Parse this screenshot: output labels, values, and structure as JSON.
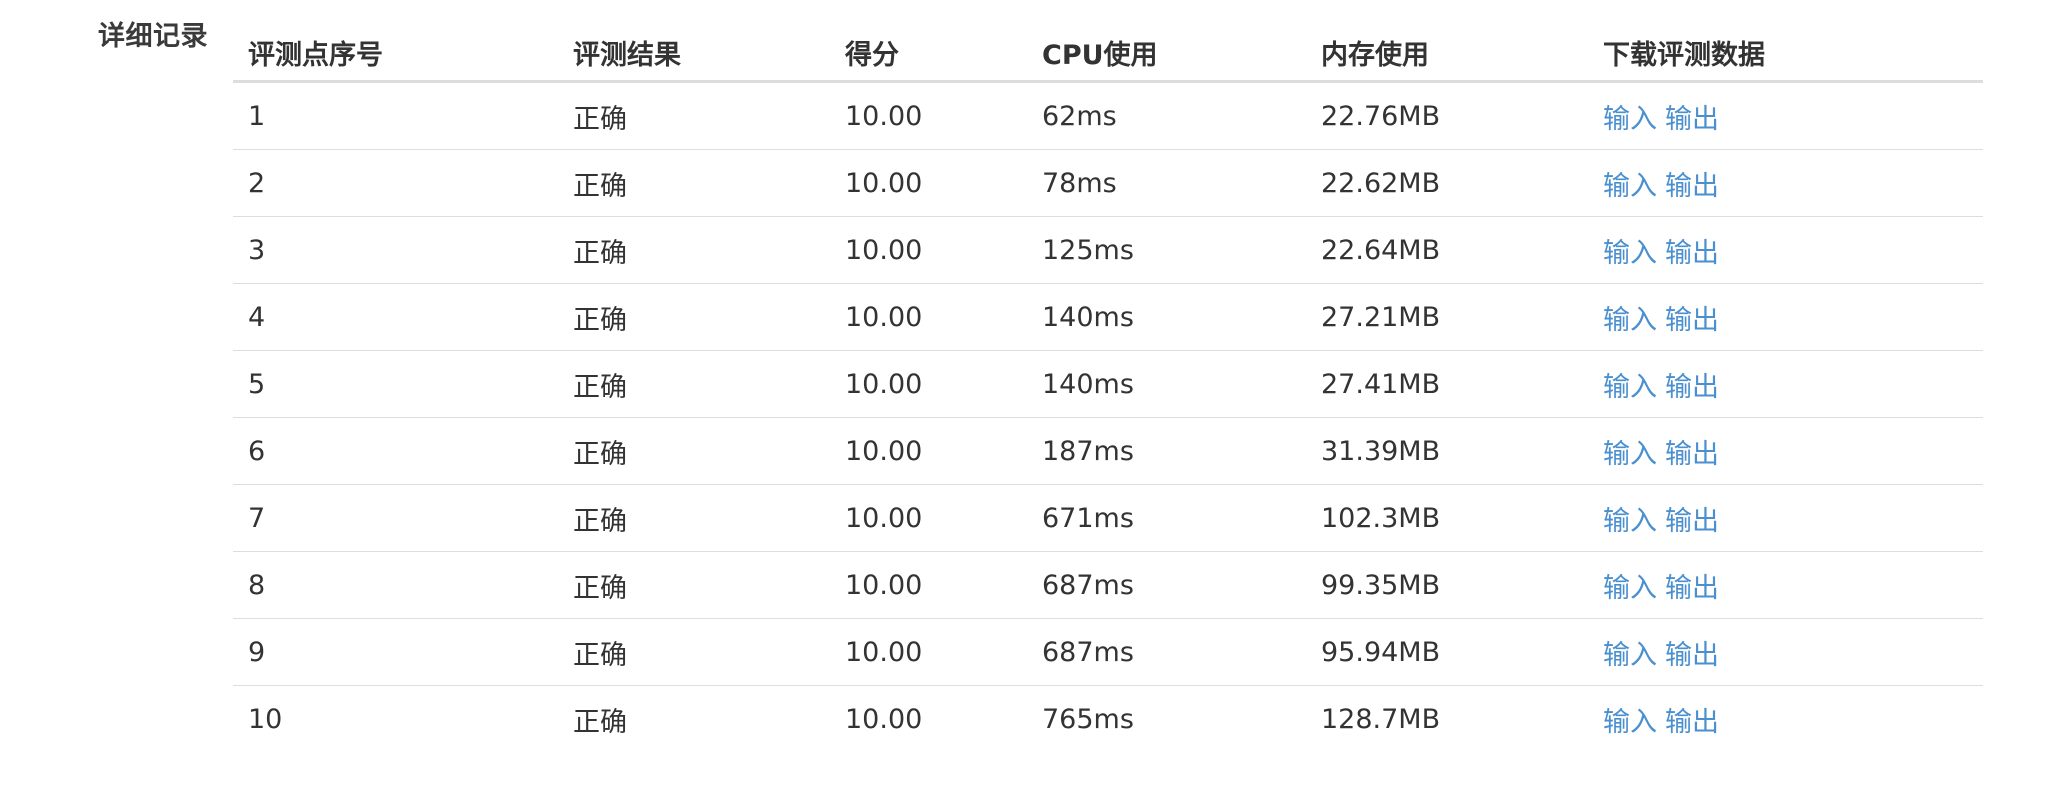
{
  "section": {
    "label": "详细记录"
  },
  "table": {
    "headers": [
      "评测点序号",
      "评测结果",
      "得分",
      "CPU使用",
      "内存使用",
      "下载评测数据"
    ],
    "rows": [
      {
        "index": "1",
        "result": "正确",
        "score": "10.00",
        "cpu": "62ms",
        "memory": "22.76MB",
        "input_link": "输入",
        "output_link": "输出"
      },
      {
        "index": "2",
        "result": "正确",
        "score": "10.00",
        "cpu": "78ms",
        "memory": "22.62MB",
        "input_link": "输入",
        "output_link": "输出"
      },
      {
        "index": "3",
        "result": "正确",
        "score": "10.00",
        "cpu": "125ms",
        "memory": "22.64MB",
        "input_link": "输入",
        "output_link": "输出"
      },
      {
        "index": "4",
        "result": "正确",
        "score": "10.00",
        "cpu": "140ms",
        "memory": "27.21MB",
        "input_link": "输入",
        "output_link": "输出"
      },
      {
        "index": "5",
        "result": "正确",
        "score": "10.00",
        "cpu": "140ms",
        "memory": "27.41MB",
        "input_link": "输入",
        "output_link": "输出"
      },
      {
        "index": "6",
        "result": "正确",
        "score": "10.00",
        "cpu": "187ms",
        "memory": "31.39MB",
        "input_link": "输入",
        "output_link": "输出"
      },
      {
        "index": "7",
        "result": "正确",
        "score": "10.00",
        "cpu": "671ms",
        "memory": "102.3MB",
        "input_link": "输入",
        "output_link": "输出"
      },
      {
        "index": "8",
        "result": "正确",
        "score": "10.00",
        "cpu": "687ms",
        "memory": "99.35MB",
        "input_link": "输入",
        "output_link": "输出"
      },
      {
        "index": "9",
        "result": "正确",
        "score": "10.00",
        "cpu": "687ms",
        "memory": "95.94MB",
        "input_link": "输入",
        "output_link": "输出"
      },
      {
        "index": "10",
        "result": "正确",
        "score": "10.00",
        "cpu": "765ms",
        "memory": "128.7MB",
        "input_link": "输入",
        "output_link": "输出"
      }
    ]
  },
  "colors": {
    "text": "#333333",
    "link": "#4a8fcf",
    "border": "#dddddd"
  }
}
